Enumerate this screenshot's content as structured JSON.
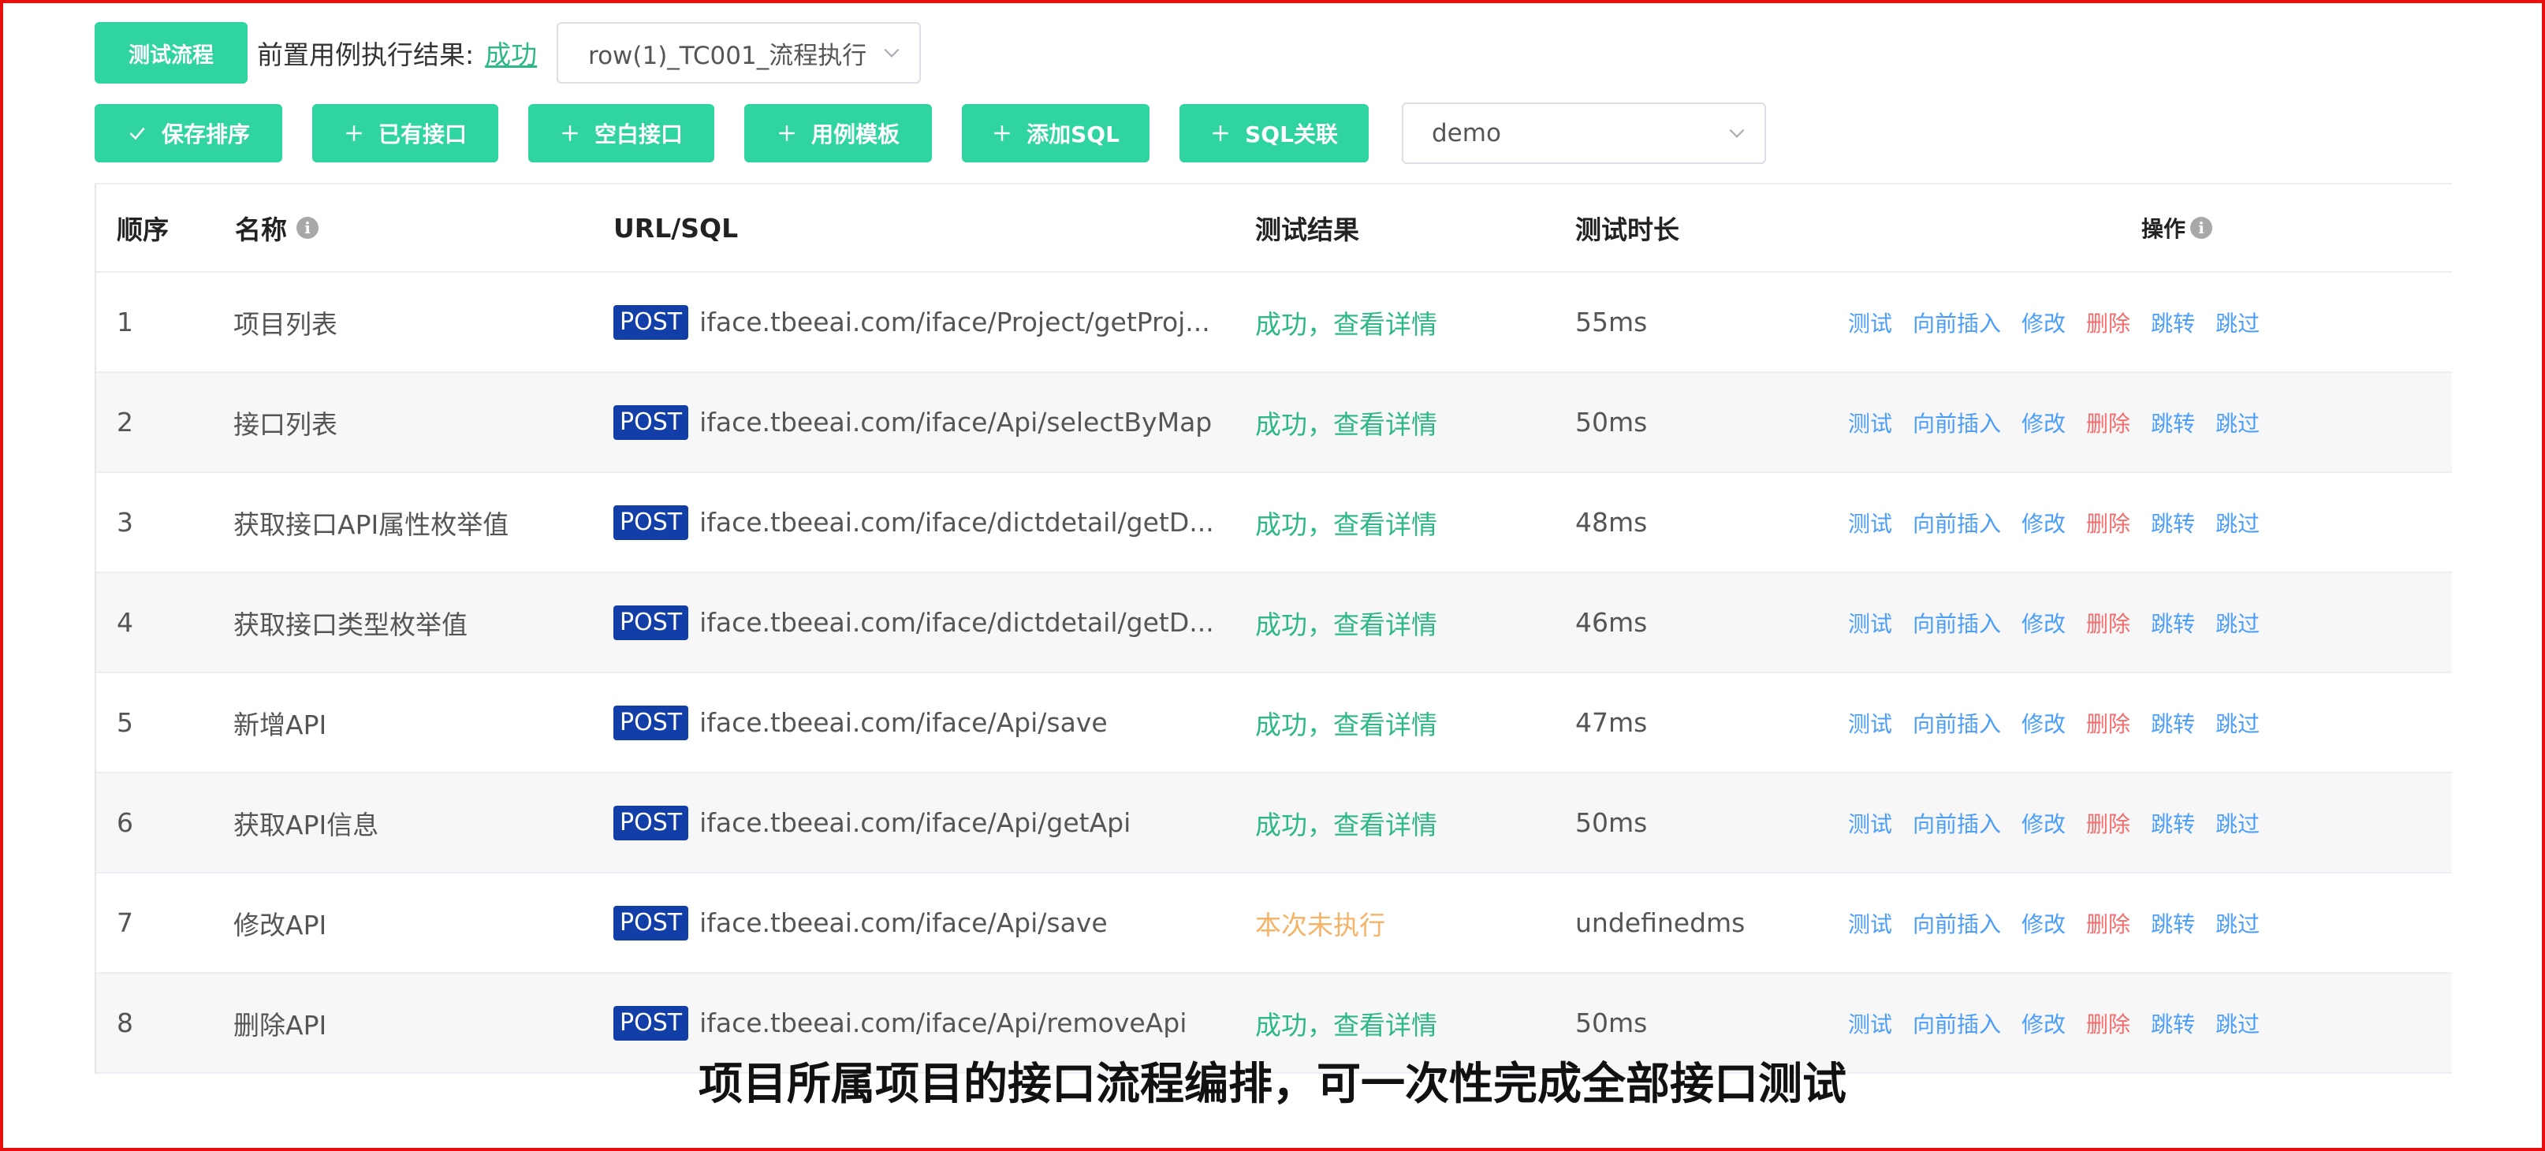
{
  "header": {
    "test_flow_button": "测试流程",
    "pre_result_label": "前置用例执行结果:",
    "pre_result_status": "成功",
    "case_select_value": "row(1)_TC001_流程执行"
  },
  "toolbar": {
    "buttons": [
      {
        "label": "保存排序",
        "icon": "check-icon"
      },
      {
        "label": "已有接口",
        "icon": "plus-icon"
      },
      {
        "label": "空白接口",
        "icon": "plus-icon"
      },
      {
        "label": "用例模板",
        "icon": "plus-icon"
      },
      {
        "label": "添加SQL",
        "icon": "plus-icon"
      },
      {
        "label": "SQL关联",
        "icon": "plus-icon"
      }
    ],
    "env_select_value": "demo"
  },
  "table": {
    "headers": {
      "seq": "顺序",
      "name": "名称",
      "url": "URL/SQL",
      "result": "测试结果",
      "duration": "测试时长",
      "ops": "操作"
    },
    "ops_labels": [
      "测试",
      "向前插入",
      "修改",
      "删除",
      "跳转",
      "跳过"
    ],
    "rows": [
      {
        "seq": "1",
        "name": "项目列表",
        "method": "POST",
        "url": "iface.tbeeai.com/iface/Project/getProj...",
        "result": "成功，查看详情",
        "status": "ok",
        "duration": "55ms"
      },
      {
        "seq": "2",
        "name": "接口列表",
        "method": "POST",
        "url": "iface.tbeeai.com/iface/Api/selectByMap",
        "result": "成功，查看详情",
        "status": "ok",
        "duration": "50ms"
      },
      {
        "seq": "3",
        "name": "获取接口API属性枚举值",
        "method": "POST",
        "url": "iface.tbeeai.com/iface/dictdetail/getD...",
        "result": "成功，查看详情",
        "status": "ok",
        "duration": "48ms"
      },
      {
        "seq": "4",
        "name": "获取接口类型枚举值",
        "method": "POST",
        "url": "iface.tbeeai.com/iface/dictdetail/getD...",
        "result": "成功，查看详情",
        "status": "ok",
        "duration": "46ms"
      },
      {
        "seq": "5",
        "name": "新增API",
        "method": "POST",
        "url": "iface.tbeeai.com/iface/Api/save",
        "result": "成功，查看详情",
        "status": "ok",
        "duration": "47ms"
      },
      {
        "seq": "6",
        "name": "获取API信息",
        "method": "POST",
        "url": "iface.tbeeai.com/iface/Api/getApi",
        "result": "成功，查看详情",
        "status": "ok",
        "duration": "50ms"
      },
      {
        "seq": "7",
        "name": "修改API",
        "method": "POST",
        "url": "iface.tbeeai.com/iface/Api/save",
        "result": "本次未执行",
        "status": "skip",
        "duration": "undefinedms"
      },
      {
        "seq": "8",
        "name": "删除API",
        "method": "POST",
        "url": "iface.tbeeai.com/iface/Api/removeApi",
        "result": "成功，查看详情",
        "status": "ok",
        "duration": "50ms"
      }
    ]
  },
  "caption": "项目所属项目的接口流程编排，可一次性完成全部接口测试",
  "colors": {
    "accent_green": "#2fd4a0",
    "link_blue": "#4a9df8",
    "delete_red": "#f56c6c",
    "success_text": "#2fb887",
    "skipped_text": "#f5b368",
    "post_badge": "#123ea8",
    "frame_red": "#e8100e"
  }
}
